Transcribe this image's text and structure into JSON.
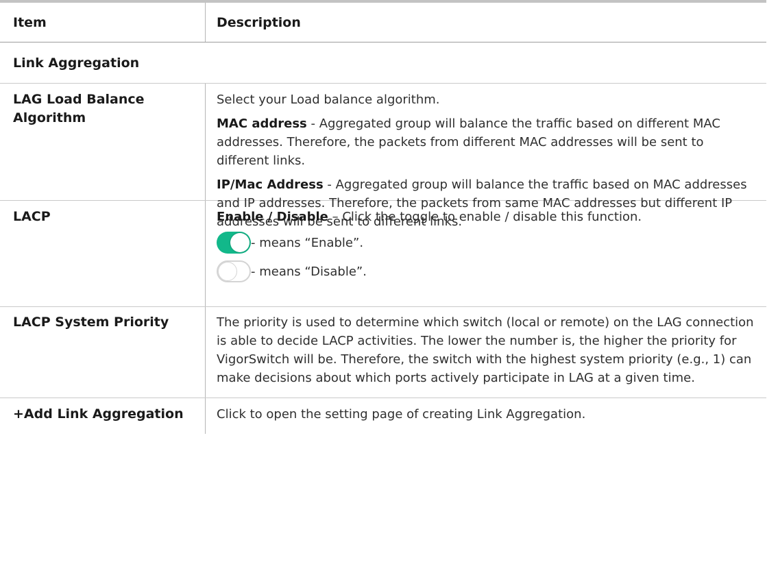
{
  "table": {
    "header": {
      "item": "Item",
      "description": "Description"
    },
    "section_title": "Link Aggregation",
    "rows": [
      {
        "item": "LAG Load Balance Algorithm",
        "intro": "Select your Load balance algorithm.",
        "p1_bold": "MAC address",
        "p1_text": " - Aggregated group will balance the traffic based on different MAC addresses. Therefore, the packets from different MAC addresses will be sent to different links.",
        "p2_bold": "IP/Mac Address",
        "p2_text": " - Aggregated group will balance the traffic based on MAC addresses and IP addresses. Therefore, the packets from same MAC addresses but different IP addresses will be sent to different links."
      },
      {
        "item": "LACP",
        "p1_bold": "Enable / Disable",
        "p1_text": " – Click the toggle to enable / disable this function.",
        "toggle_on_text": " - means “Enable”.",
        "toggle_off_text": " - means “Disable”."
      },
      {
        "item": "LACP System Priority",
        "text": "The priority is used to determine which switch (local or remote) on the LAG connection is able to decide LACP activities. The lower the number is, the higher the priority for VigorSwitch will be. Therefore, the switch with the highest system priority (e.g., 1) can make decisions about which ports actively participate in LAG at a given time."
      },
      {
        "item": "+Add Link Aggregation",
        "text": "Click to open the setting page of creating Link Aggregation."
      }
    ]
  },
  "colors": {
    "toggle_on": "#12b88a",
    "toggle_off_border": "#d4d4d4",
    "rule": "#9c9c9c"
  }
}
